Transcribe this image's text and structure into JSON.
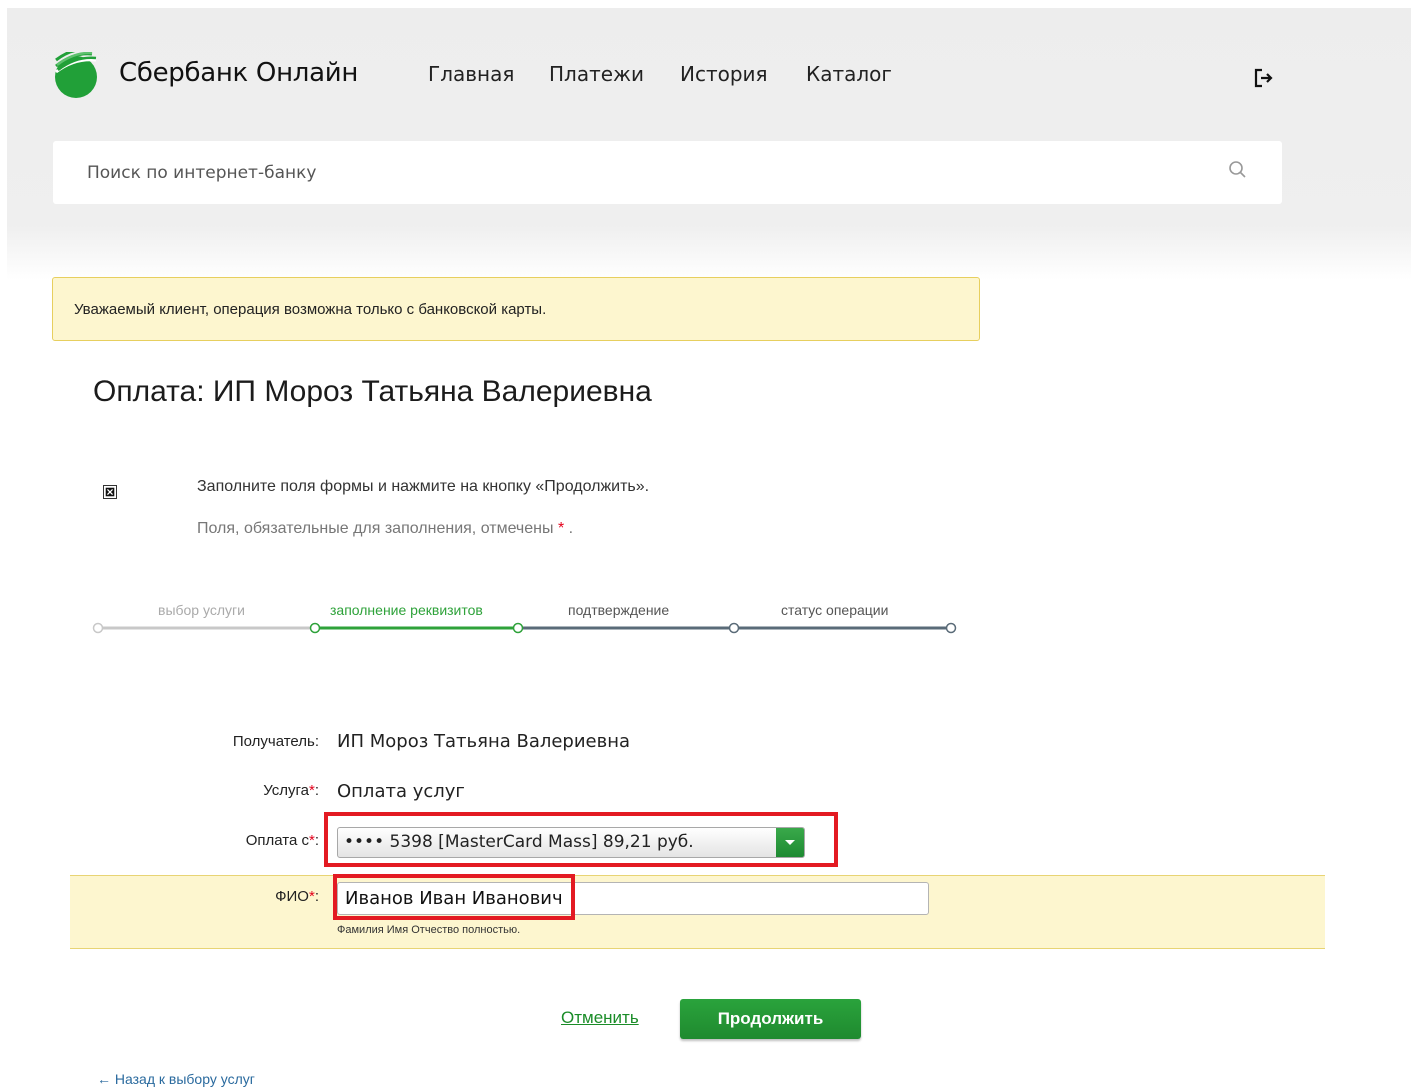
{
  "header": {
    "brand": "Сбербанк Онлайн",
    "nav": [
      "Главная",
      "Платежи",
      "История",
      "Каталог"
    ],
    "logout_icon": "logout-icon"
  },
  "search": {
    "placeholder": "Поиск по интернет-банку",
    "icon": "search-icon"
  },
  "notice": {
    "text": "Уважаемый клиент, операция возможна только с банковской карты."
  },
  "page": {
    "title": "Оплата: ИП Мороз Татьяна Валериевна"
  },
  "instructions": {
    "line1": "Заполните поля формы и нажмите на кнопку «Продолжить».",
    "line2_prefix": "Поля, обязательные для заполнения, отмечены",
    "required_mark": "*",
    "line2_suffix": "."
  },
  "steps": [
    {
      "label": "выбор услуги",
      "state": "done"
    },
    {
      "label": "заполнение реквизитов",
      "state": "current"
    },
    {
      "label": "подтверждение",
      "state": "upcoming"
    },
    {
      "label": "статус операции",
      "state": "upcoming"
    }
  ],
  "form": {
    "recipient_label": "Получатель:",
    "recipient_value": "ИП Мороз Татьяна Валериевна",
    "service_label": "Услуга",
    "service_value": "Оплата услуг",
    "pay_from_label": "Оплата с",
    "pay_from_value": "•••• 5398 [MasterCard Mass] 89,21 руб.",
    "fio_label": "ФИО",
    "fio_value": "Иванов Иван Иванович",
    "fio_hint": "Фамилия Имя Отчество полностью.",
    "required_mark": "*",
    "colon": ":"
  },
  "actions": {
    "cancel": "Отменить",
    "continue": "Продолжить",
    "back": "← Назад к выбору услуг"
  },
  "colors": {
    "brand_green": "#21a038",
    "highlight_red": "#e31a22",
    "notice_bg": "#fdf6cf"
  }
}
